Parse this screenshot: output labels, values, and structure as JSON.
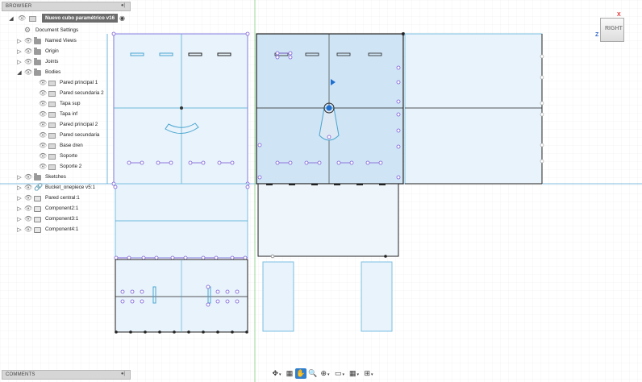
{
  "browser": {
    "title": "BROWSER",
    "document_title": "Nuevo cubo paramétrico v16",
    "items": [
      {
        "label": "Document Settings",
        "icon": "gear-icon"
      },
      {
        "label": "Named Views",
        "icon": "folder-icon"
      },
      {
        "label": "Origin",
        "icon": "folder-icon"
      },
      {
        "label": "Joints",
        "icon": "folder-icon"
      },
      {
        "label": "Bodies",
        "icon": "folder-icon"
      },
      {
        "label": "Pared principal 1",
        "icon": "body-icon"
      },
      {
        "label": "Pared secundaria 2",
        "icon": "body-icon"
      },
      {
        "label": "Tapa sup",
        "icon": "body-icon"
      },
      {
        "label": "Tapa inf",
        "icon": "body-icon"
      },
      {
        "label": "Pared principal 2",
        "icon": "body-icon"
      },
      {
        "label": "Pared secundaria",
        "icon": "body-icon"
      },
      {
        "label": "Base dren",
        "icon": "body-icon"
      },
      {
        "label": "Soporte",
        "icon": "body-icon"
      },
      {
        "label": "Soporte 2",
        "icon": "body-icon"
      },
      {
        "label": "Sketches",
        "icon": "folder-icon"
      },
      {
        "label": "Bucket_onepiece v5:1",
        "icon": "link-icon"
      },
      {
        "label": "Pared central:1",
        "icon": "component-icon"
      },
      {
        "label": "Component2:1",
        "icon": "component-icon"
      },
      {
        "label": "Component3:1",
        "icon": "component-icon"
      },
      {
        "label": "Component4:1",
        "icon": "component-icon"
      }
    ]
  },
  "comments": {
    "title": "COMMENTS"
  },
  "viewcube": {
    "face": "RIGHT",
    "axis_x": "X",
    "axis_z": "Z"
  },
  "toolbar": {
    "icons": [
      "orbit-icon",
      "look-at-icon",
      "pan-icon",
      "zoom-icon",
      "fit-icon",
      "display-settings-icon",
      "grid-settings-icon",
      "viewports-icon"
    ],
    "active": "pan-icon"
  },
  "colors": {
    "panel_fill": "#e6f2fb",
    "panel_stroke": "#7bbfe0",
    "grid": "#e9e9e9",
    "constraint": "#7b5bd6",
    "selected_fill": "#cfe4f5",
    "accent": "#1e6fd0"
  }
}
